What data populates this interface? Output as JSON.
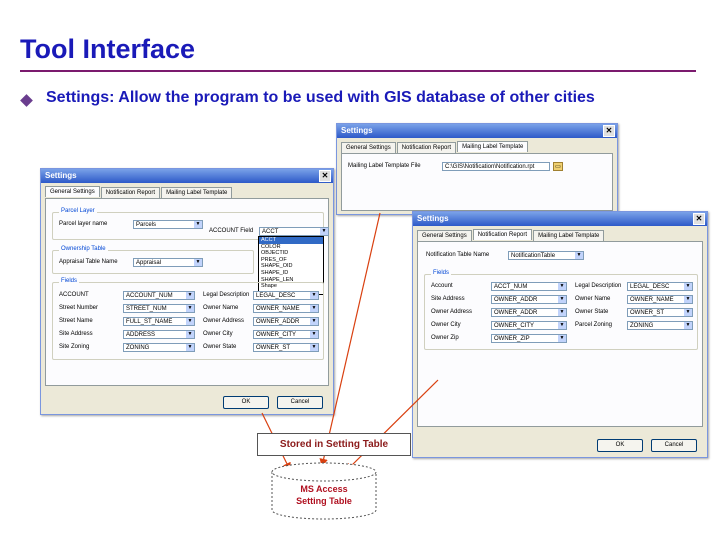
{
  "slide": {
    "title": "Tool Interface",
    "bullet": "Settings: Allow the program to be used with GIS database of other cities",
    "title_color": "#1a1ab8",
    "rule_color": "#7b1a6e"
  },
  "win_back": {
    "title": "Settings",
    "tabs": [
      "General Settings",
      "Notification Report",
      "Mailing Label Template"
    ],
    "label": "Mailing Label Template File",
    "value": "C:\\GIS\\Notification\\Notification.rpt"
  },
  "win_left": {
    "title": "Settings",
    "tabs": [
      "General Settings",
      "Notification Report",
      "Mailing Label Template"
    ],
    "group_parcel": "Parcel Layer",
    "parcel_layer_label": "Parcel layer name",
    "parcel_layer_value": "Parcels",
    "account_field_label": "ACCOUNT Field",
    "account_field_value": "ACCT",
    "account_field_options": [
      "ACCT",
      "COLOR",
      "OBJECTID",
      "PRES_OF",
      "SHAPE_OID",
      "SHAPE_ID",
      "SHAPE_LEN",
      "Shape"
    ],
    "group_ownership": "Ownership Table",
    "ownership_label": "Appraisal Table Name",
    "ownership_value": "Appraisal",
    "group_fields": "Fields",
    "fields": [
      {
        "label": "ACCOUNT",
        "value": "ACCOUNT_NUM",
        "label2": "Legal Description",
        "value2": "LEGAL_DESC"
      },
      {
        "label": "Street Number",
        "value": "STREET_NUM",
        "label2": "Owner Name",
        "value2": "OWNER_NAME"
      },
      {
        "label": "Street Name",
        "value": "FULL_ST_NAME",
        "label2": "Owner Address",
        "value2": "OWNER_ADDR"
      },
      {
        "label": "Site Address",
        "value": "ADDRESS",
        "label2": "Owner City",
        "value2": "OWNER_CITY"
      },
      {
        "label": "Site Zoning",
        "value": "ZONING",
        "label2": "Owner State",
        "value2": "OWNER_ST"
      }
    ],
    "ok": "OK",
    "cancel": "Cancel"
  },
  "win_right": {
    "title": "Settings",
    "tabs": [
      "General Settings",
      "Notification Report",
      "Mailing Label Template"
    ],
    "table_label": "Notification Table Name",
    "table_value": "NotificationTable",
    "group_fields": "Fields",
    "fields": [
      {
        "label": "Account",
        "value": "ACCT_NUM",
        "label2": "Legal Description",
        "value2": "LEGAL_DESC"
      },
      {
        "label": "Site Address",
        "value": "OWNER_ADDR",
        "label2": "Owner Name",
        "value2": "OWNER_NAME"
      },
      {
        "label": "Owner Address",
        "value": "OWNER_ADDR",
        "label2": "Owner State",
        "value2": "OWNER_ST"
      },
      {
        "label": "Owner City",
        "value": "OWNER_CITY",
        "label2": "Parcel Zoning",
        "value2": "ZONING"
      },
      {
        "label": "Owner Zip",
        "value": "OWNER_ZIP",
        "label2": "",
        "value2": ""
      }
    ],
    "ok": "OK",
    "cancel": "Cancel"
  },
  "diagram": {
    "stored_label": "Stored in Setting Table",
    "db_label_line1": "MS Access",
    "db_label_line2": "Setting Table",
    "arrow_color": "#d94010",
    "db_text_color": "#b01020"
  }
}
